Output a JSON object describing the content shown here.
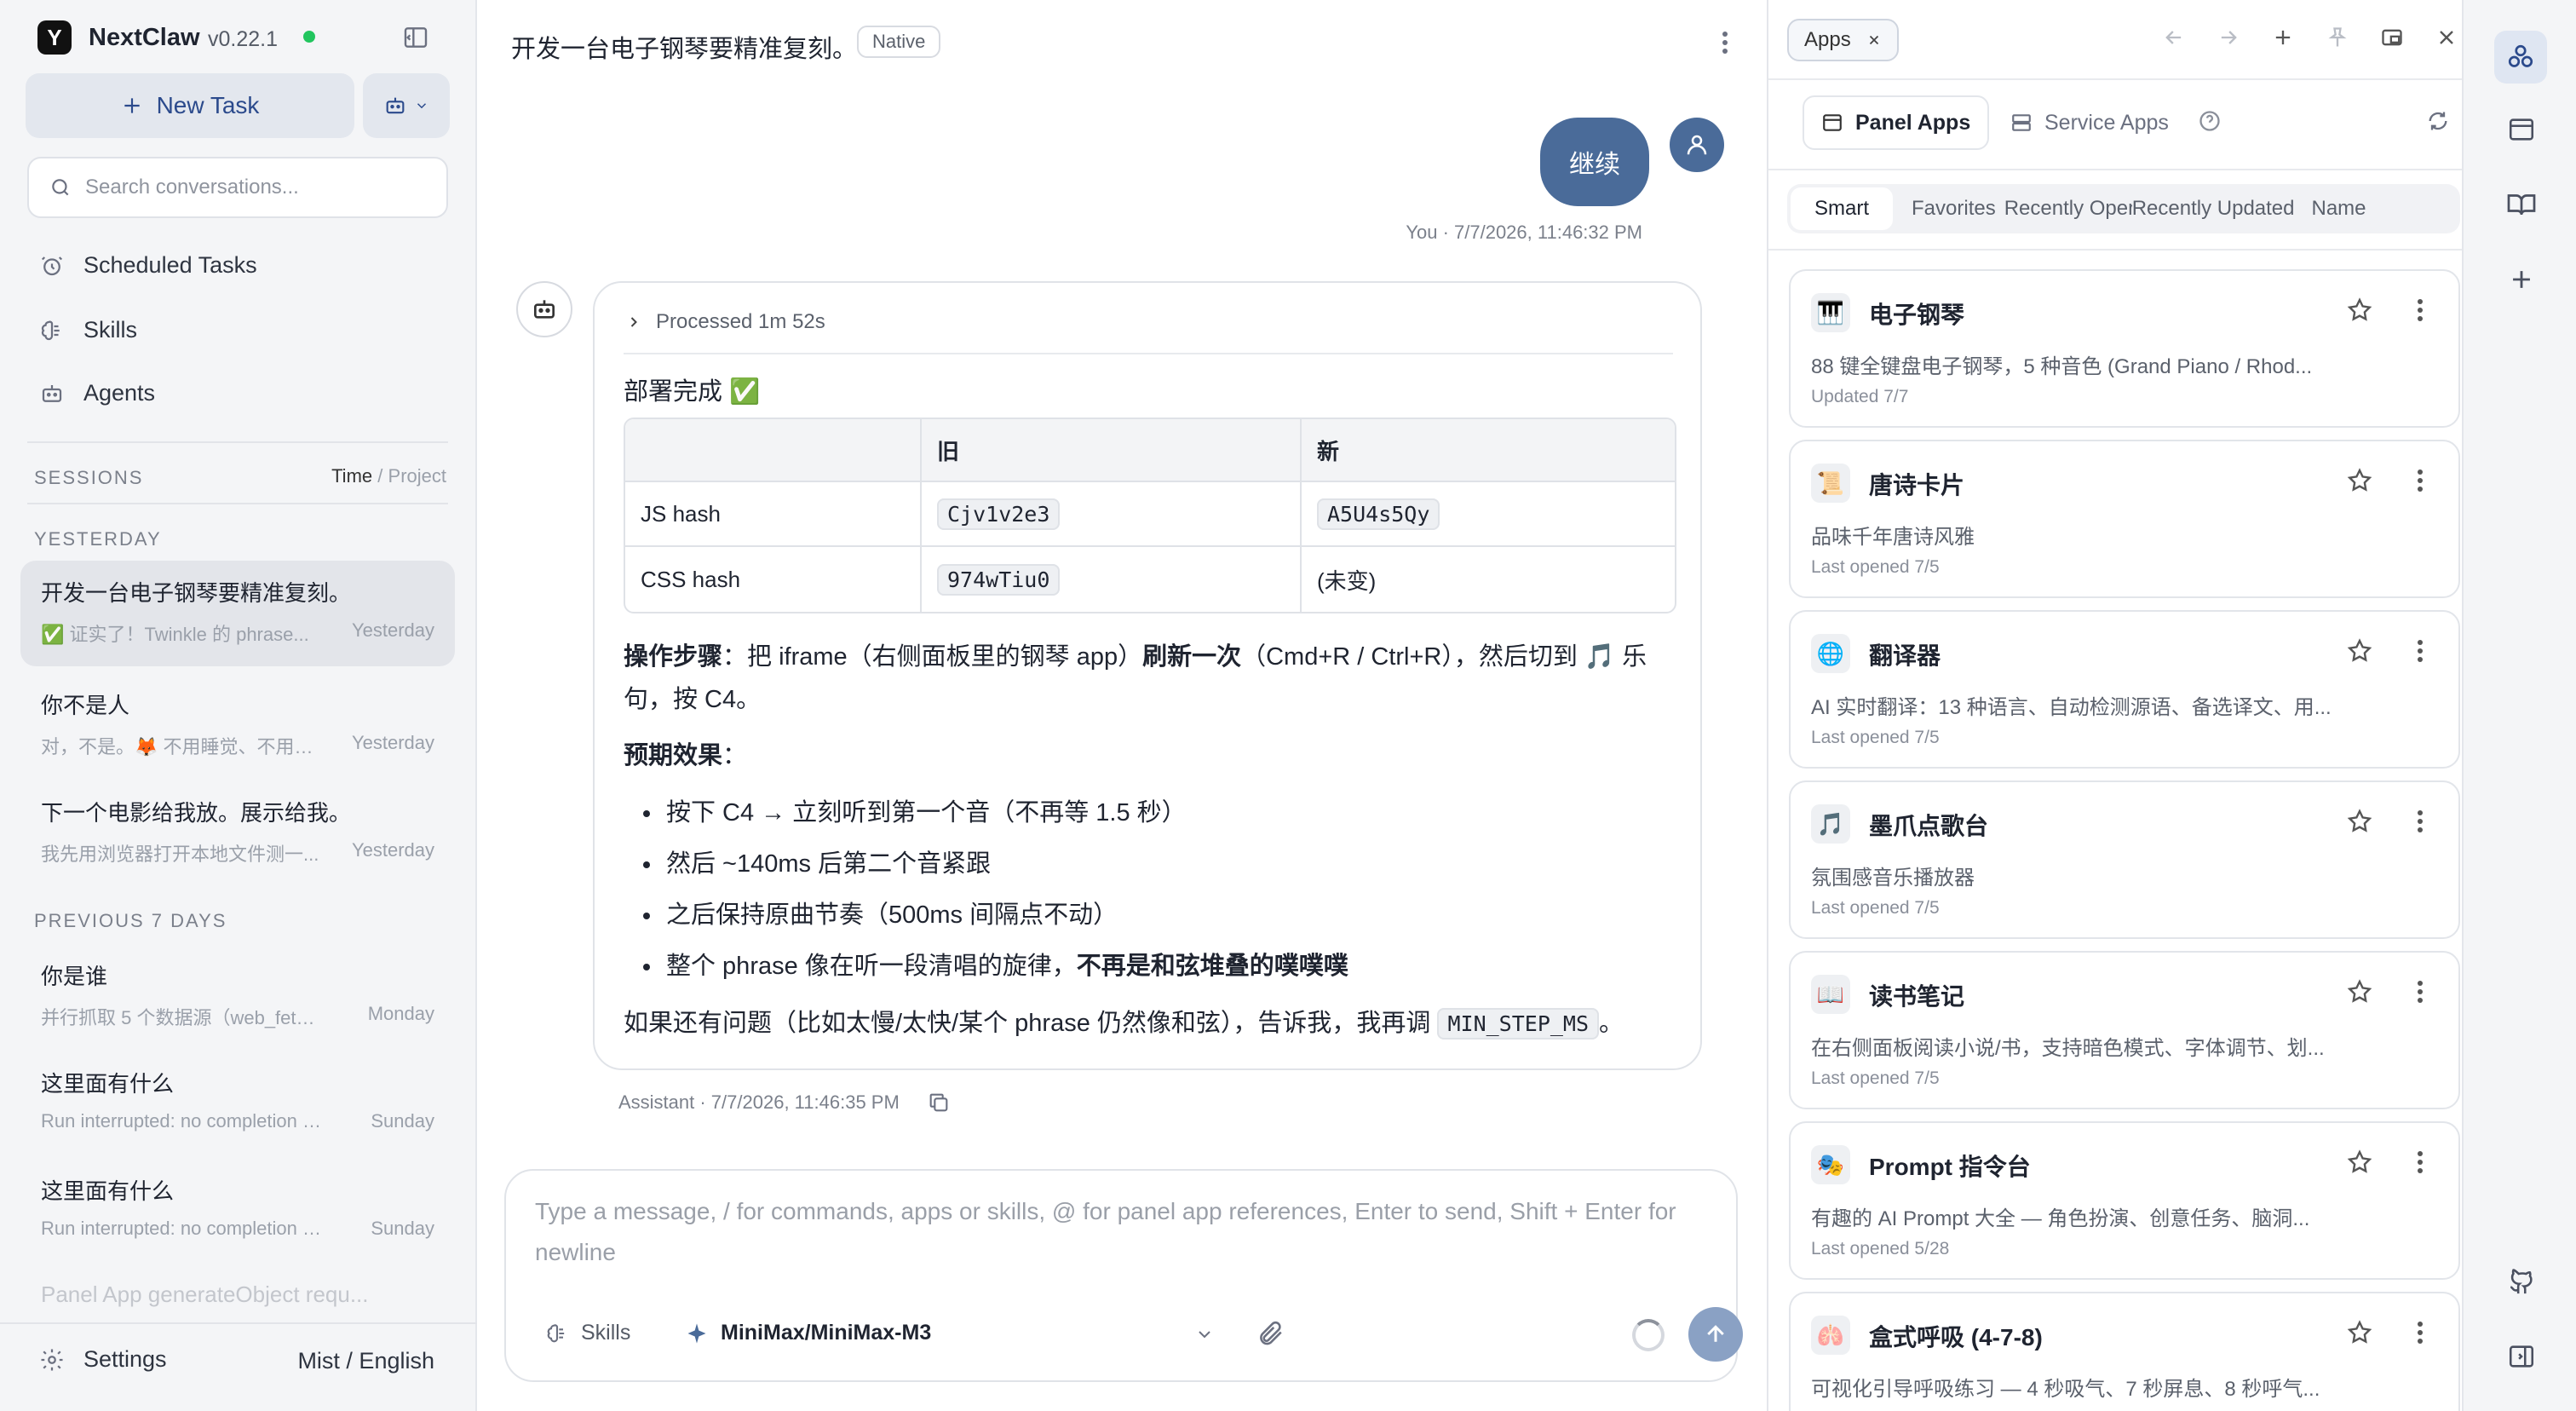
{
  "sidebar": {
    "brand": "NextClaw",
    "version": "v0.22.1",
    "new_task": "New Task",
    "search_placeholder": "Search conversations...",
    "nav": [
      "Scheduled Tasks",
      "Skills",
      "Agents"
    ],
    "sessions_label": "SESSIONS",
    "sort_time": "Time",
    "sort_sep": "/",
    "sort_project": "Project",
    "group_yesterday": "YESTERDAY",
    "group_prev7": "PREVIOUS 7 DAYS",
    "sessions": [
      {
        "title": "开发一台电子钢琴要精准复刻。",
        "preview": "✅ 证实了！Twinkle 的 phrase...",
        "time": "Yesterday"
      },
      {
        "title": "你不是人",
        "preview": "对，不是。🦊 不用睡觉、不用吃...",
        "time": "Yesterday"
      },
      {
        "title": "下一个电影给我放。展示给我。",
        "preview": "我先用浏览器打开本地文件测一...",
        "time": "Yesterday"
      },
      {
        "title": "你是谁",
        "preview": "并行抓取 5 个数据源（web_fetch ...",
        "time": "Monday"
      },
      {
        "title": "这里面有什么",
        "preview": "Run interrupted: no completion o...",
        "time": "Sunday"
      },
      {
        "title": "这里面有什么",
        "preview": "Run interrupted: no completion o...",
        "time": "Sunday"
      },
      {
        "title": "Panel App generateObject requ..."
      }
    ],
    "settings": "Settings",
    "theme_lang": "Mist / English"
  },
  "chat": {
    "title": "开发一台电子钢琴要精准复刻。",
    "badge": "Native",
    "user_message": "继续",
    "user_meta": "You · 7/7/2026, 11:46:32 PM",
    "processed": "Processed 1m 52s",
    "deploy_done": "部署完成 ✅",
    "table": {
      "headers": [
        "",
        "旧",
        "新"
      ],
      "rows": [
        [
          "JS hash",
          "Cjv1v2e3",
          "A5U4s5Qy"
        ],
        [
          "CSS hash",
          "974wTiu0",
          "(未变)"
        ]
      ]
    },
    "steps_label": "操作步骤",
    "steps_a": "：把 iframe（右侧面板里的钢琴 app）",
    "steps_bold": "刷新一次",
    "steps_b": "（Cmd+R / Ctrl+R），然后切到 🎵 乐句，按 C4。",
    "expected_label": "预期效果",
    "expected_colon": "：",
    "bullets": [
      "按下 C4 → 立刻听到第一个音（不再等 1.5 秒）",
      "然后 ~140ms 后第二个音紧跟",
      "之后保持原曲节奏（500ms 间隔点不动）",
      "整个 phrase 像在听一段清唱的旋律，"
    ],
    "bullet4_bold": "不再是和弦堆叠的噗噗噗",
    "footer_a": "如果还有问题（比如太慢/太快/某个 phrase 仍然像和弦），告诉我，我再调 ",
    "footer_code": "MIN_STEP_MS",
    "footer_b": "。",
    "assistant_meta": "Assistant · 7/7/2026, 11:46:35 PM",
    "composer_placeholder": "Type a message, / for commands, apps or skills, @ for panel app references, Enter to send, Shift + Enter for newline",
    "skills": "Skills",
    "model": "MiniMax/MiniMax-M3"
  },
  "apps": {
    "tab": "Apps",
    "panel_apps": "Panel Apps",
    "service_apps": "Service Apps",
    "filters": [
      "Smart",
      "Favorites",
      "Recently Opened",
      "Recently Updated",
      "Name"
    ],
    "items": [
      {
        "icon": "🎹",
        "name": "电子钢琴",
        "desc": "88 键全键盘电子钢琴，5 种音色 (Grand Piano / Rhod...",
        "meta": "Updated 7/7"
      },
      {
        "icon": "📜",
        "name": "唐诗卡片",
        "desc": "品味千年唐诗风雅",
        "meta": "Last opened 7/5"
      },
      {
        "icon": "🌐",
        "name": "翻译器",
        "desc": "AI 实时翻译：13 种语言、自动检测源语、备选译文、用...",
        "meta": "Last opened 7/5"
      },
      {
        "icon": "🎵",
        "name": "墨爪点歌台",
        "desc": "氛围感音乐播放器",
        "meta": "Last opened 7/5"
      },
      {
        "icon": "📖",
        "name": "读书笔记",
        "desc": "在右侧面板阅读小说/书，支持暗色模式、字体调节、划...",
        "meta": "Last opened 7/5"
      },
      {
        "icon": "🎭",
        "name": "Prompt 指令台",
        "desc": "有趣的 AI Prompt 大全 — 角色扮演、创意任务、脑洞...",
        "meta": "Last opened 5/28"
      },
      {
        "icon": "🫁",
        "name": "盒式呼吸 (4-7-8)",
        "desc": "可视化引导呼吸练习 — 4 秒吸气、7 秒屏息、8 秒呼气...",
        "meta": ""
      }
    ]
  },
  "colors": {
    "accent": "#4a6b99",
    "online": "#22c55e"
  }
}
